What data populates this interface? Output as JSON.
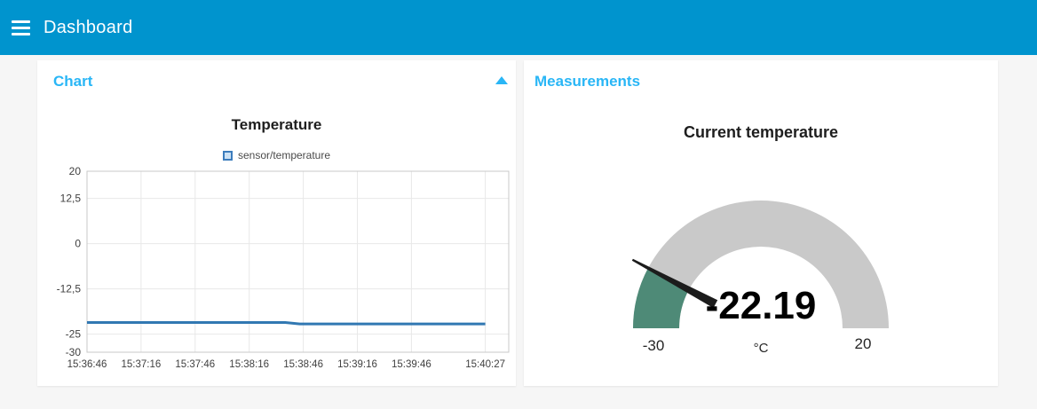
{
  "header": {
    "title": "Dashboard",
    "bg_color": "#0094CE",
    "menu_icon": "hamburger-icon"
  },
  "theme": {
    "page_bg": "#F6F6F6",
    "panel_bg": "#FFFFFF",
    "accent": "#29B6F6",
    "title_text": "#1E1E1E",
    "axis_text": "#404040",
    "grid_color": "#E8E8E8",
    "border_color": "#C9C9C9"
  },
  "chart_panel": {
    "title": "Chart",
    "collapse_icon": "triangle-up-icon",
    "chart_title": "Temperature",
    "legend": {
      "label": "sensor/temperature",
      "swatch_border": "#3C7CBC",
      "swatch_fill": "#CCE1F4"
    }
  },
  "measurements_panel": {
    "title": "Measurements",
    "widget_title": "Current temperature",
    "gauge": {
      "value_label": "-22.19",
      "min_label": "-30",
      "max_label": "20",
      "unit": "°C"
    }
  },
  "chart_data": [
    {
      "type": "line",
      "title": "Temperature",
      "series": [
        {
          "name": "sensor/temperature",
          "color": "#3178B2",
          "points": [
            {
              "t": "15:36:46",
              "v": -21.8
            },
            {
              "t": "15:38:36",
              "v": -21.8
            },
            {
              "t": "15:38:44",
              "v": -22.19
            },
            {
              "t": "15:40:27",
              "v": -22.19
            }
          ]
        }
      ],
      "x_ticks": [
        "15:36:46",
        "15:37:16",
        "15:37:46",
        "15:38:16",
        "15:38:46",
        "15:39:16",
        "15:39:46",
        "15:40:27"
      ],
      "x_domain": [
        "15:36:46",
        "15:40:40"
      ],
      "y_ticks": [
        {
          "v": 20,
          "label": "20"
        },
        {
          "v": 12.5,
          "label": "12,5"
        },
        {
          "v": 0,
          "label": "0"
        },
        {
          "v": -12.5,
          "label": "-12,5"
        },
        {
          "v": -25,
          "label": "-25"
        },
        {
          "v": -30,
          "label": "-30"
        }
      ],
      "ylim": [
        -30,
        20
      ],
      "grid": true,
      "legend_position": "top"
    },
    {
      "type": "gauge",
      "title": "Current temperature",
      "value": -22.19,
      "min": -30,
      "max": 20,
      "unit": "°C",
      "arc_color": "#C9C9C9",
      "level_color": "#4E8A77",
      "needle_color": "#1C1C1C"
    }
  ]
}
